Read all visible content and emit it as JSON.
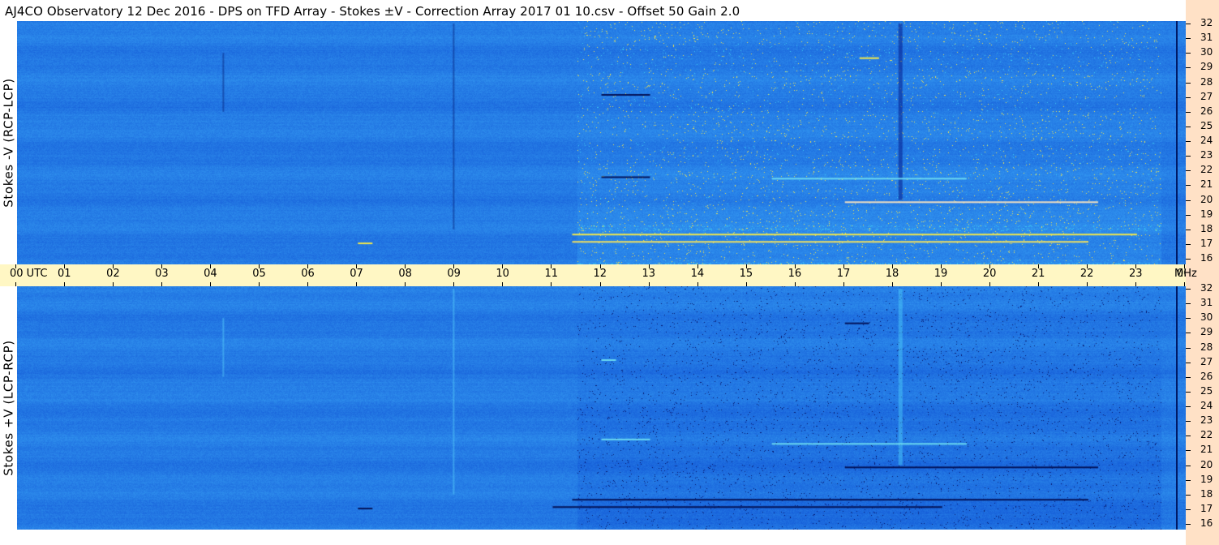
{
  "title": "AJ4CO Observatory  12 Dec 2016  -  DPS on TFD Array  -  Stokes ±V  -  Correction Array 2017 01 10.csv  -  Offset 50  Gain 2.0",
  "chart_data": [
    {
      "type": "heatmap",
      "ylabel": "Stokes -V (RCP-LCP)",
      "x_tick_labels": [
        "00 UTC",
        "01",
        "02",
        "03",
        "04",
        "05",
        "06",
        "07",
        "08",
        "09",
        "10",
        "11",
        "12",
        "13",
        "14",
        "15",
        "16",
        "17",
        "18",
        "19",
        "20",
        "21",
        "22",
        "23",
        "00"
      ],
      "x_unit": "UTC hour",
      "y_tick_labels": [
        "32",
        "31",
        "30",
        "29",
        "28",
        "27",
        "26",
        "25",
        "24",
        "23",
        "22",
        "21",
        "20",
        "19",
        "18",
        "17",
        "16"
      ],
      "y_unit": "MHz",
      "xlim": [
        0,
        24
      ],
      "ylim": [
        16,
        32
      ],
      "colors": {
        "background": "#1f73e8",
        "enhanced": "#33c4f0",
        "strong": "#f2e84a",
        "dark": "#04145a"
      }
    },
    {
      "type": "heatmap",
      "ylabel": "Stokes +V (LCP-RCP)",
      "x_tick_labels": [
        "00 UTC",
        "01",
        "02",
        "03",
        "04",
        "05",
        "06",
        "07",
        "08",
        "09",
        "10",
        "11",
        "12",
        "13",
        "14",
        "15",
        "16",
        "17",
        "18",
        "19",
        "20",
        "21",
        "22",
        "23",
        "00"
      ],
      "x_unit": "UTC hour",
      "y_tick_labels": [
        "32",
        "31",
        "30",
        "29",
        "28",
        "27",
        "26",
        "25",
        "24",
        "23",
        "22",
        "21",
        "20",
        "19",
        "18",
        "17",
        "16"
      ],
      "y_unit": "MHz",
      "xlim": [
        0,
        24
      ],
      "ylim": [
        16,
        32
      ],
      "colors": {
        "background": "#1f73e8",
        "enhanced": "#33c4f0",
        "strong": "#f2e84a",
        "dark": "#04145a"
      }
    }
  ],
  "freq_unit_label": "MHz"
}
